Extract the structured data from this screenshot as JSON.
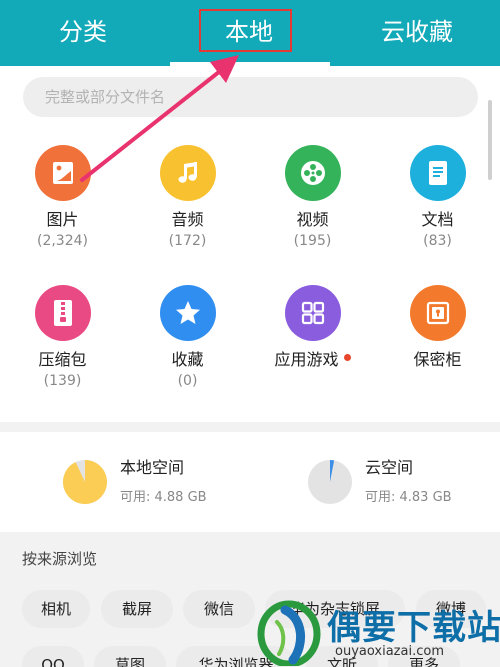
{
  "tabs": {
    "category": "分类",
    "local": "本地",
    "cloud": "云收藏"
  },
  "search": {
    "placeholder": "完整或部分文件名"
  },
  "categories": [
    {
      "label": "图片",
      "count": "(2,324)",
      "color": "#f0713a",
      "icon": "image-icon"
    },
    {
      "label": "音频",
      "count": "(172)",
      "color": "#f8c12f",
      "icon": "music-icon"
    },
    {
      "label": "视频",
      "count": "(195)",
      "color": "#35b35a",
      "icon": "film-reel-icon"
    },
    {
      "label": "文档",
      "count": "(83)",
      "color": "#1db0dd",
      "icon": "document-icon"
    },
    {
      "label": "压缩包",
      "count": "(139)",
      "color": "#ea4a84",
      "icon": "zip-icon"
    },
    {
      "label": "收藏",
      "count": "(0)",
      "color": "#2f8ef0",
      "icon": "star-icon"
    },
    {
      "label": "应用游戏",
      "count": "",
      "color": "#8a5ddf",
      "icon": "apps-grid-icon"
    },
    {
      "label": "保密柜",
      "count": "",
      "color": "#f37a2c",
      "icon": "safe-icon"
    }
  ],
  "storage": {
    "local": {
      "title": "本地空间",
      "available": "可用: 4.88 GB",
      "used_fraction": 0.93,
      "color": "#fbcd54"
    },
    "cloud": {
      "title": "云空间",
      "available": "可用: 4.83 GB",
      "used_fraction": 0.03,
      "color": "#3d8ee8"
    }
  },
  "browse": {
    "title": "按来源浏览",
    "chips_row1": [
      "相机",
      "截屏",
      "微信",
      "华为杂志锁屏",
      "微博"
    ],
    "chips_row2": [
      "QQ",
      "草图",
      "华为浏览器",
      "文昕",
      "更多"
    ]
  },
  "watermark": {
    "brand": "偶要下载站",
    "url": "ouyaoxiazai.com"
  },
  "colors": {
    "header": "#12a9b9",
    "annotation": "#e53935",
    "arrow": "#e8336f"
  }
}
